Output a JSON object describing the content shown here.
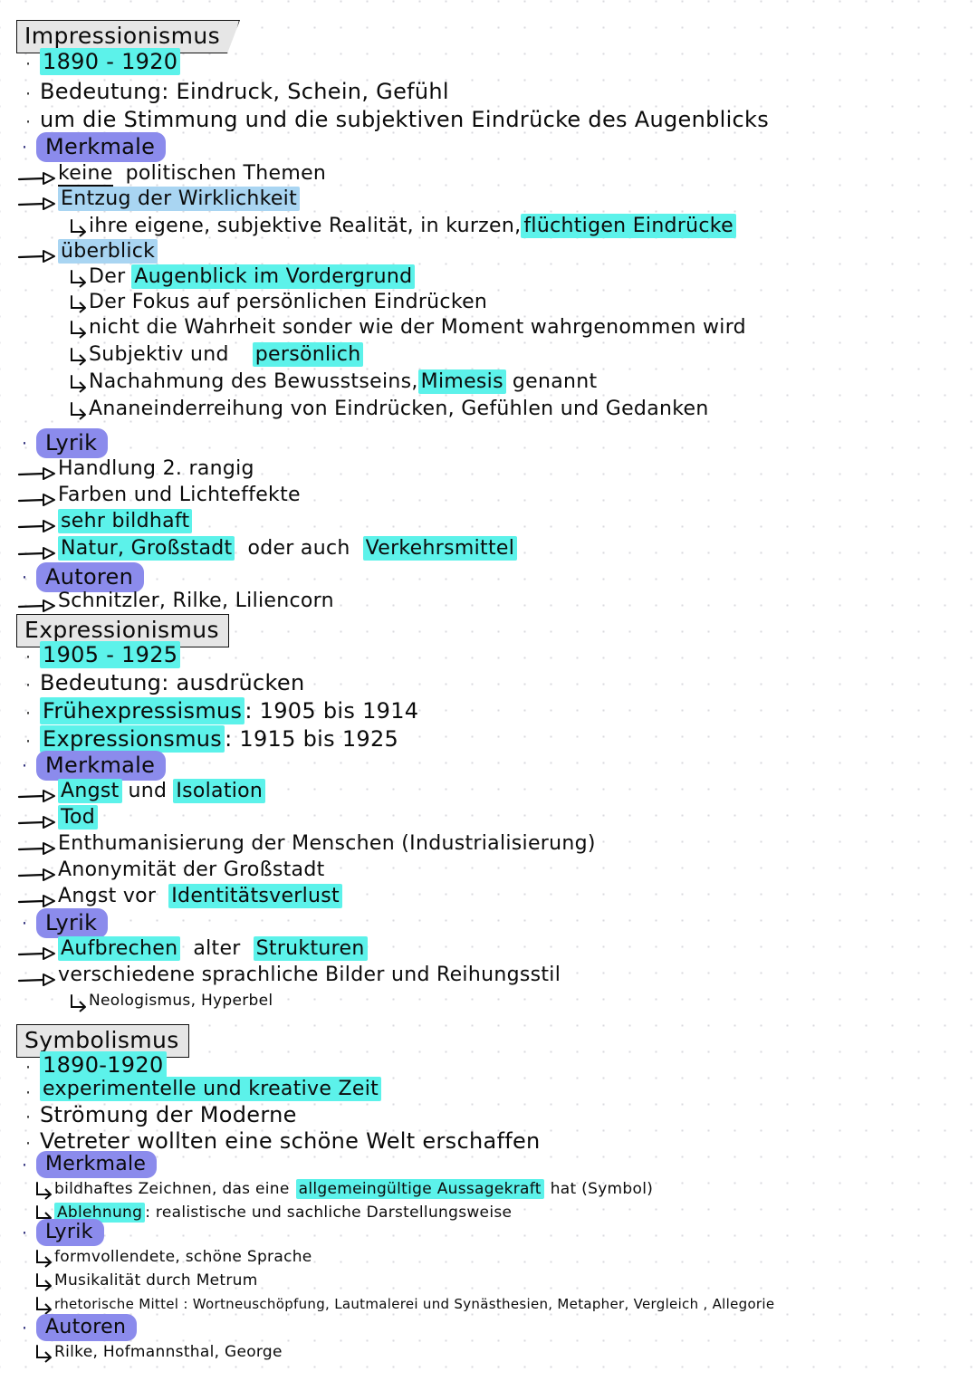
{
  "page": {
    "language": "de",
    "background": "#ffffff",
    "dot_grid_color": "#d9d9de",
    "ink_color": "#0b0b0b"
  },
  "colors": {
    "highlight_cyan": "#5cf2ea",
    "highlight_blue": "#a9d5f2",
    "highlight_purple": "#8b8bec",
    "title_box_fill": "#e6e6e6",
    "title_box_border": "#111111"
  },
  "sections": [
    {
      "title": "Impressionismus",
      "lines": {
        "years": "1890 - 1920",
        "meaning": "Bedeutung: Eindruck, Schein, Gefühl",
        "purpose": "um die Stimmung und die subjektiven Eindrücke des Augenblicks",
        "merkmale_label": "Merkmale",
        "m1": "keine",
        "m1_rest": "politischen Themen",
        "m2": "Entzug der Wirklichkeit",
        "m2_sub_a": "ihre eigene, subjektive Realität, in kurzen,",
        "m2_sub_b": "flüchtigen Eindrücke",
        "m3": "überblick",
        "s1_a": "Der",
        "s1_b": "Augenblick im Vordergrund",
        "s2": "Der Fokus auf persönlichen Eindrücken",
        "s3": "nicht die Wahrheit sonder wie der Moment wahrgenommen wird",
        "s4_a": "Subjektiv und",
        "s4_b": "persönlich",
        "s5_a": "Nachahmung des Bewusstseins,",
        "s5_b": "Mimesis",
        "s5_c": "genannt",
        "s6": "Ananeinderreihung von Eindrücken, Gefühlen und Gedanken",
        "lyrik_label": "Lyrik",
        "l1": "Handlung 2. rangig",
        "l2": "Farben und Lichteffekte",
        "l3": "sehr bildhaft",
        "l4_a": "Natur, Großstadt",
        "l4_b": "oder auch",
        "l4_c": "Verkehrsmittel",
        "autoren_label": "Autoren",
        "a1": "Schnitzler, Rilke, Liliencorn"
      }
    },
    {
      "title": "Expressionismus",
      "lines": {
        "years": "1905 - 1925",
        "meaning": "Bedeutung: ausdrücken",
        "early_a": "Frühexpressismus",
        "early_b": ": 1905 bis 1914",
        "late_a": "Expressionsmus",
        "late_b": ": 1915 bis 1925",
        "merkmale_label": "Merkmale",
        "m1_a": "Angst",
        "m1_b": "und",
        "m1_c": "Isolation",
        "m2": "Tod",
        "m3": "Enthumanisierung der Menschen (Industrialisierung)",
        "m4": "Anonymität der Großstadt",
        "m5_a": "Angst vor",
        "m5_b": "Identitätsverlust",
        "lyrik_label": "Lyrik",
        "l1_a": "Aufbrechen",
        "l1_b": "alter",
        "l1_c": "Strukturen",
        "l2": "verschiedene sprachliche Bilder und Reihungsstil",
        "l2_sub": "Neologismus, Hyperbel"
      }
    },
    {
      "title": "Symbolismus",
      "lines": {
        "years": "1890-1920",
        "experimental": "experimentelle und kreative Zeit",
        "stroemung": "Strömung der Moderne",
        "vertreter": "Vetreter wollten eine schöne Welt erschaffen",
        "merkmale_label": "Merkmale",
        "m1_a": "bildhaftes Zeichnen, das eine",
        "m1_b": "allgemeingültige Aussagekraft",
        "m1_c": "hat  (Symbol)",
        "m2_a": "Ablehnung",
        "m2_b": ": realistische und sachliche Darstellungsweise",
        "lyrik_label": "Lyrik",
        "l1": "formvollendete, schöne Sprache",
        "l2": "Musikalität durch Metrum",
        "l3": "rhetorische Mittel : Wortneuschöpfung, Lautmalerei  und  Synästhesien, Metapher, Vergleich , Allegorie",
        "autoren_label": "Autoren",
        "a1": "Rilke, Hofmannsthal, George"
      }
    }
  ]
}
